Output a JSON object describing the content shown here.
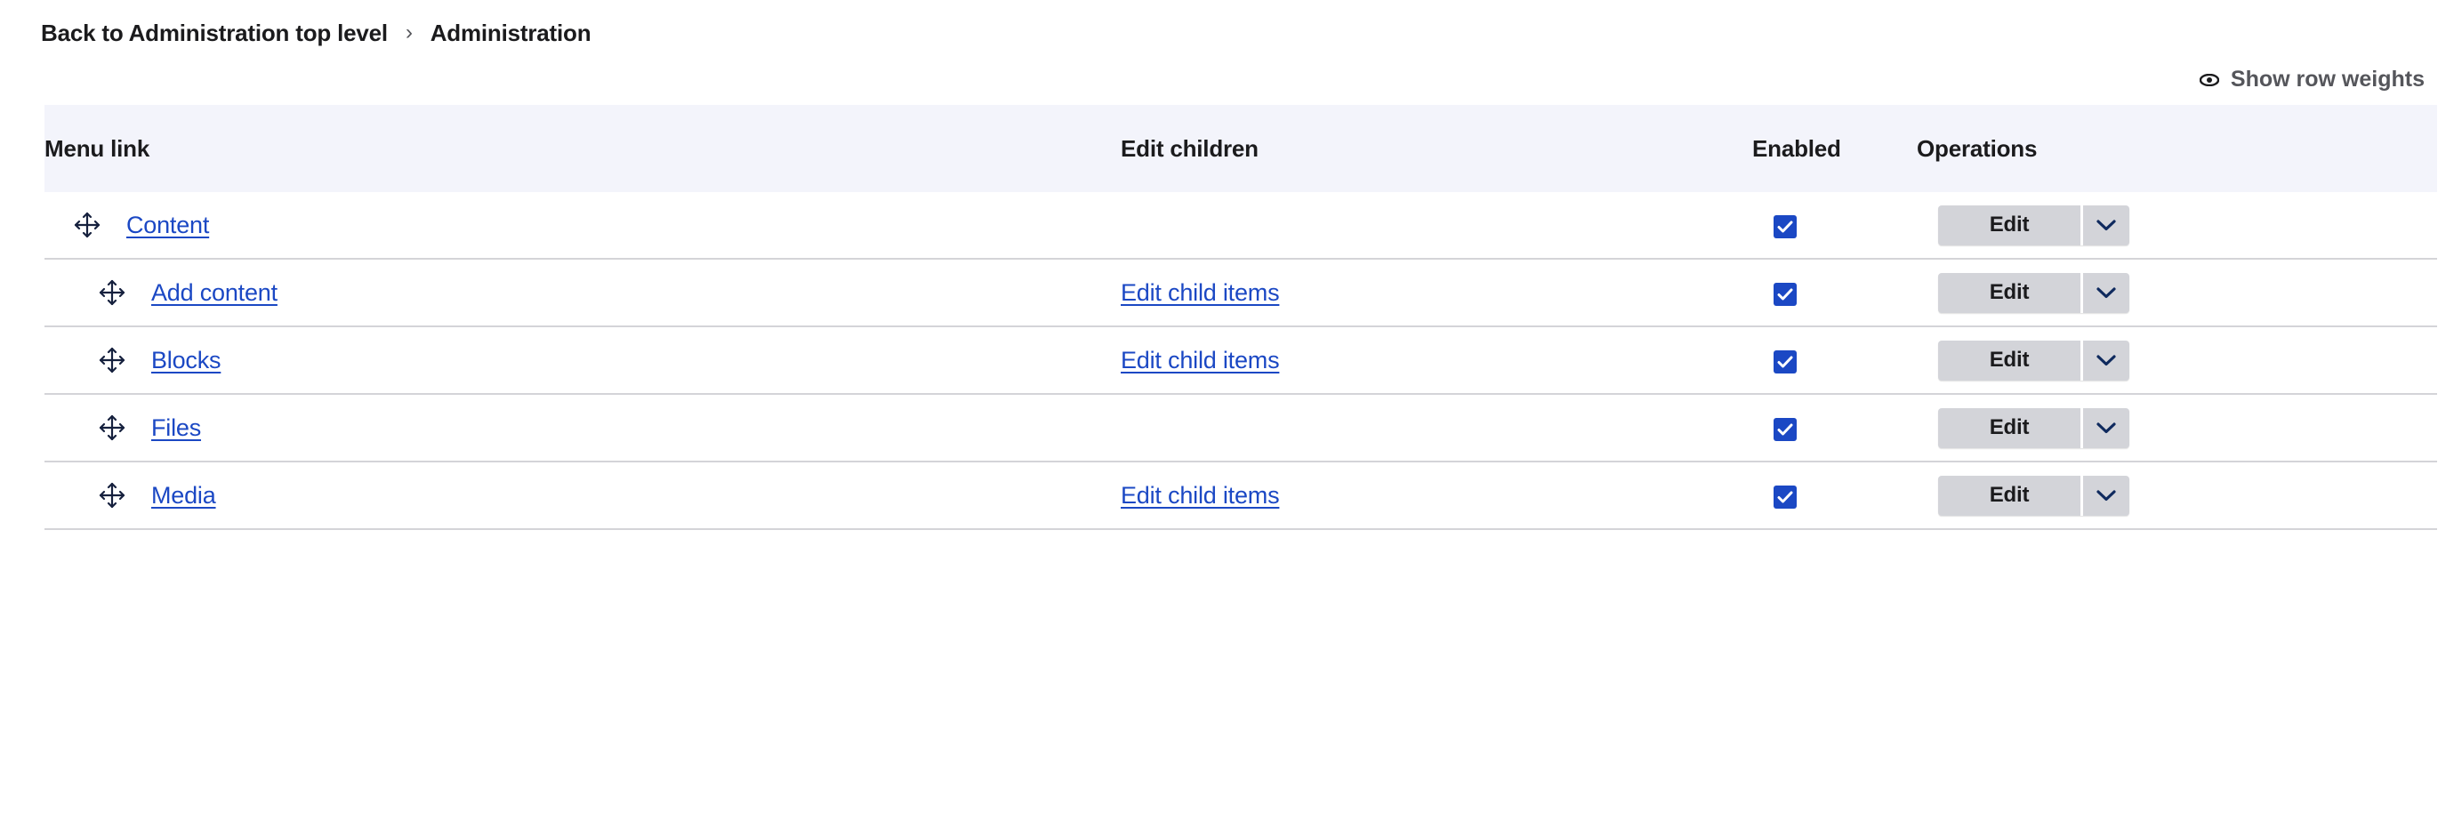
{
  "breadcrumb": {
    "items": [
      {
        "label": "Back to Administration top level",
        "interactable": true
      },
      {
        "label": "Administration",
        "interactable": false
      }
    ],
    "separator": "›"
  },
  "row_weights": {
    "label": "Show row weights",
    "icon": "eye-icon"
  },
  "table": {
    "columns": {
      "menu_link": "Menu link",
      "edit_children": "Edit children",
      "enabled": "Enabled",
      "operations": "Operations"
    },
    "rows": [
      {
        "label": "Content",
        "depth": 0,
        "edit_children": "",
        "enabled": true,
        "operation_label": "Edit",
        "drag_icon": "move-arrows-icon"
      },
      {
        "label": "Add content",
        "depth": 1,
        "edit_children": "Edit child items",
        "enabled": true,
        "operation_label": "Edit",
        "drag_icon": "move-arrows-icon"
      },
      {
        "label": "Blocks",
        "depth": 1,
        "edit_children": "Edit child items",
        "enabled": true,
        "operation_label": "Edit",
        "drag_icon": "move-arrows-icon"
      },
      {
        "label": "Files",
        "depth": 1,
        "edit_children": "",
        "enabled": true,
        "operation_label": "Edit",
        "drag_icon": "move-arrows-icon"
      },
      {
        "label": "Media",
        "depth": 1,
        "edit_children": "Edit child items",
        "enabled": true,
        "operation_label": "Edit",
        "drag_icon": "move-arrows-icon"
      }
    ]
  },
  "colors": {
    "link": "#1b48c4",
    "checkbox_checked": "#1b48c4",
    "header_bg": "#f3f4fb",
    "button_bg": "#d3d4d9",
    "row_border": "#d4d4d8",
    "muted_text": "#55565b"
  }
}
